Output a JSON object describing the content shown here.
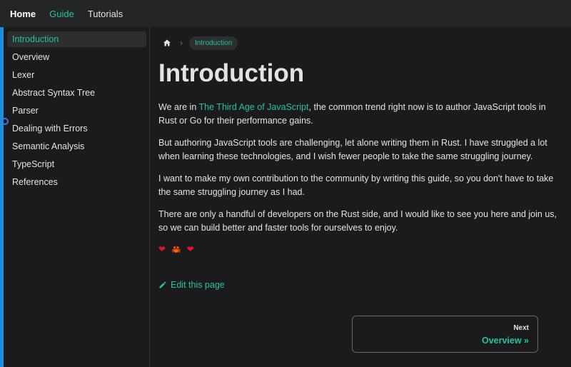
{
  "topnav": {
    "home": "Home",
    "guide": "Guide",
    "tutorials": "Tutorials"
  },
  "sidebar": {
    "items": [
      {
        "label": "Introduction",
        "active": true
      },
      {
        "label": "Overview"
      },
      {
        "label": "Lexer"
      },
      {
        "label": "Abstract Syntax Tree"
      },
      {
        "label": "Parser"
      },
      {
        "label": "Dealing with Errors"
      },
      {
        "label": "Semantic Analysis"
      },
      {
        "label": "TypeScript"
      },
      {
        "label": "References"
      }
    ]
  },
  "breadcrumb": {
    "separator": "›",
    "current": "Introduction"
  },
  "main": {
    "title": "Introduction",
    "p1_pre": "We are in ",
    "p1_link": "The Third Age of JavaScript",
    "p1_post": ", the common trend right now is to author JavaScript tools in Rust or Go for their performance gains.",
    "p2": "But authoring JavaScript tools are challenging, let alone writing them in Rust. I have struggled a lot when learning these technologies, and I wish fewer people to take the same struggling journey.",
    "p3": "I want to make my own contribution to the community by writing this guide, so you don't have to take the same struggling journey as I had.",
    "p4": "There are only a handful of developers on the Rust side, and I would like to see you here and join us, so we can build better and faster tools for ourselves to enjoy.",
    "emoji_heart": "❤",
    "emoji_crab": "🦀",
    "edit_label": "Edit this page"
  },
  "pagination": {
    "next_sub": "Next",
    "next_title": "Overview »"
  },
  "colors": {
    "accent": "#25c2a0",
    "background": "#1b1b1d",
    "navbar": "#242526",
    "left_bar": "#1d8fe0"
  }
}
